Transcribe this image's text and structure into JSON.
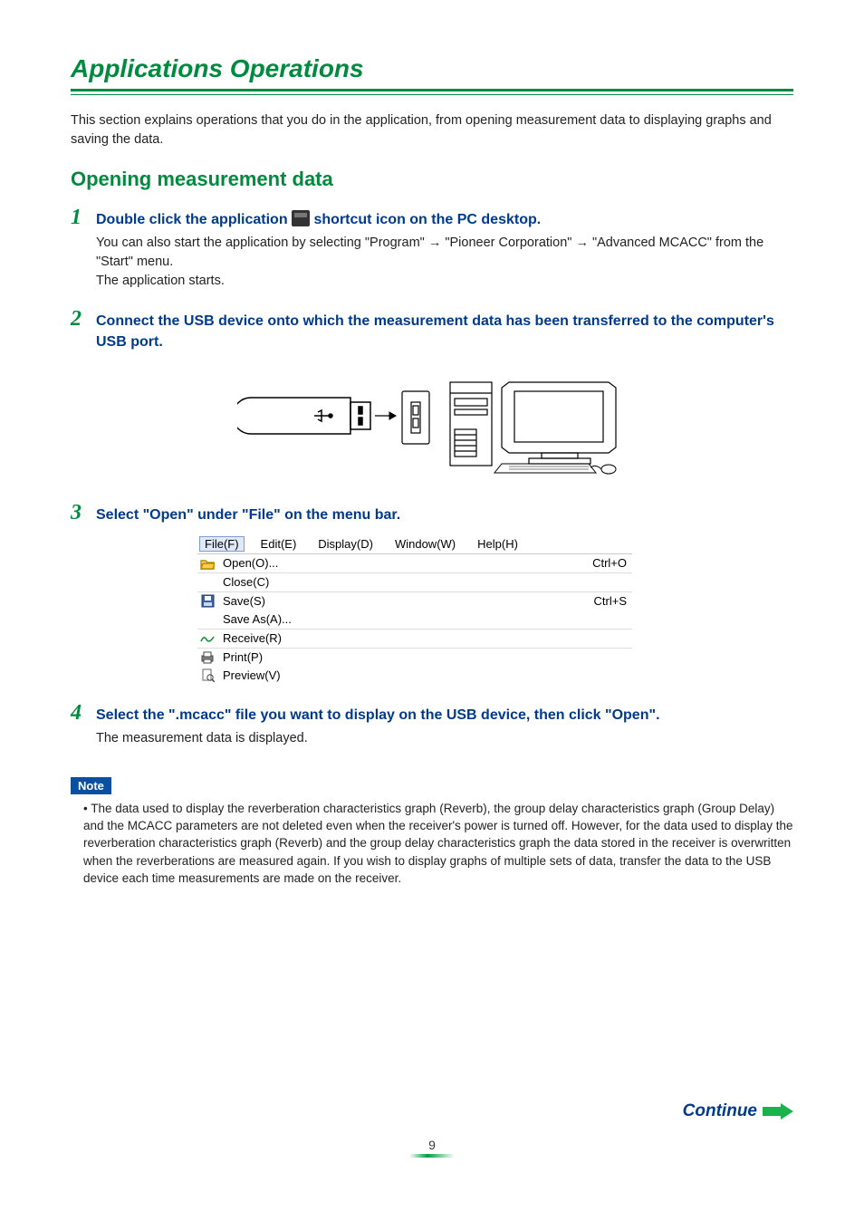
{
  "title": "Applications Operations",
  "intro": "This section explains operations that you do in the application, from opening measurement data to displaying graphs and saving the data.",
  "section_heading": "Opening measurement data",
  "steps": {
    "s1": {
      "num": "1",
      "title_a": "Double click the application ",
      "title_b": " shortcut icon on the PC desktop.",
      "body1": "You can also start the application by selecting \"Program\" → \"Pioneer Corporation\" → \"Advanced MCACC\" from the \"Start\" menu.",
      "body2": "The application starts."
    },
    "s2": {
      "num": "2",
      "title": "Connect the USB device onto which the measurement data has been transferred to the computer's USB port."
    },
    "s3": {
      "num": "3",
      "title": "Select \"Open\" under \"File\" on the menu bar."
    },
    "s4": {
      "num": "4",
      "title": "Select the \".mcacc\" file you want to display on the USB device, then click \"Open\".",
      "body": "The measurement data is displayed."
    }
  },
  "menu": {
    "bar": {
      "file": "File(F)",
      "edit": "Edit(E)",
      "display": "Display(D)",
      "window": "Window(W)",
      "help": "Help(H)"
    },
    "items": [
      {
        "icon": "open-icon",
        "label": "Open(O)...",
        "shortcut": "Ctrl+O"
      },
      {
        "icon": "",
        "label": "Close(C)",
        "shortcut": ""
      },
      {
        "icon": "save-icon",
        "label": "Save(S)",
        "shortcut": "Ctrl+S"
      },
      {
        "icon": "",
        "label": "Save As(A)...",
        "shortcut": ""
      },
      {
        "icon": "receive-icon",
        "label": "Receive(R)",
        "shortcut": ""
      },
      {
        "icon": "print-icon",
        "label": "Print(P)",
        "shortcut": ""
      },
      {
        "icon": "preview-icon",
        "label": "Preview(V)",
        "shortcut": ""
      }
    ]
  },
  "note": {
    "label": "Note",
    "text": "The data used to display the reverberation characteristics graph (Reverb), the group delay characteristics graph (Group Delay) and the MCACC parameters are not deleted even when the receiver's power is turned off. However, for the data used to display the reverberation characteristics graph (Reverb) and the group delay characteristics graph the data stored in the receiver is overwritten when the reverberations are measured again. If you wish to display graphs of multiple sets of data, transfer the data to the USB device each time measurements are made on the receiver."
  },
  "continue": "Continue",
  "page_number": "9"
}
